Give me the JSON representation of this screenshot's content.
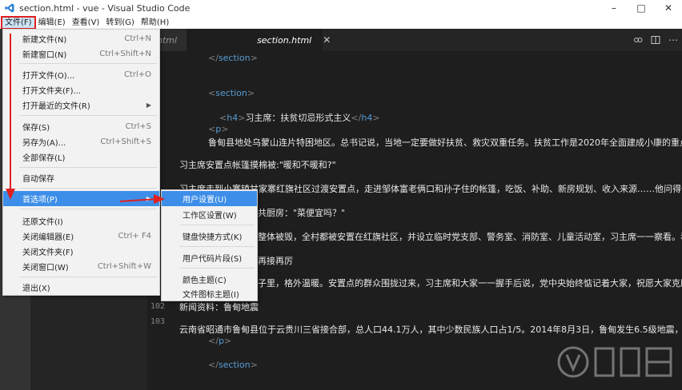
{
  "window": {
    "title": "section.html - vue - Visual Studio Code"
  },
  "menubar": {
    "items": [
      "文件(F)",
      "编辑(E)",
      "查看(V)",
      "转到(G)",
      "帮助(H)"
    ]
  },
  "tabs": [
    {
      "label": "html",
      "active": false
    },
    {
      "label": "section.html",
      "active": true
    }
  ],
  "file_menu": {
    "items": [
      {
        "label": "新建文件(N)",
        "shortcut": "Ctrl+N"
      },
      {
        "label": "新建窗口(N)",
        "shortcut": "Ctrl+Shift+N"
      },
      {
        "label": "打开文件(O)...",
        "shortcut": "Ctrl+O"
      },
      {
        "label": "打开文件夹(F)...",
        "shortcut": ""
      },
      {
        "label": "打开最近的文件(R)",
        "shortcut": ""
      },
      {
        "label": "保存(S)",
        "shortcut": "Ctrl+S"
      },
      {
        "label": "另存为(A)...",
        "shortcut": "Ctrl+Shift+S"
      },
      {
        "label": "全部保存(L)",
        "shortcut": ""
      },
      {
        "label": "自动保存",
        "shortcut": ""
      },
      {
        "label": "首选项(P)",
        "shortcut": ""
      },
      {
        "label": "还原文件(I)",
        "shortcut": ""
      },
      {
        "label": "关闭编辑器(E)",
        "shortcut": "Ctrl+ F4"
      },
      {
        "label": "关闭文件夹(F)",
        "shortcut": ""
      },
      {
        "label": "关闭窗口(W)",
        "shortcut": "Ctrl+Shift+W"
      },
      {
        "label": "退出(X)",
        "shortcut": ""
      }
    ]
  },
  "prefs_submenu": {
    "items": [
      "用户设置(U)",
      "工作区设置(W)",
      "键盘快捷方式(K)",
      "用户代码片段(S)",
      "颜色主题(C)",
      "文件图标主题(I)"
    ]
  },
  "editor": {
    "line_numbers": [
      "102",
      "103"
    ],
    "lines": {
      "l1_tag": "section",
      "l2_tag": "section",
      "l3_tag": "h4",
      "l3_text": "习主席：扶贫切忌形式主义",
      "l4_tag": "p",
      "l5": "鲁甸县地处乌蒙山连片特困地区。总书记说，当地一定要做好扶贫、救灾双重任务。扶贫工作是2020年全面建成小康的重点",
      "l6": "习主席安置点帐篷摸棉被:\"暖和不暖和?\"",
      "l7": "习主席走到小寨镇甘家寨红旗社区过渡安置点，走进邹体富老俩口和孙子住的帐篷，吃饭、补助、新房规划、收入来源……他问得十分",
      "l8": "共厨房：\"菜便宜吗？\"",
      "l9": "整体被毁，全村都被安置在红旗社区，并设立临时党支部、警务室、消防室、儿童活动室，习主席一一察看。看",
      "l10": "再接再厉",
      "l11": "子里，格外温暖。安置点的群众围拢过来，习主席和大家一一握手后说，党中央始终惦记着大家，祝愿大家克服",
      "l12": "新闻资料：鲁甸地震",
      "l13": "云南省昭通市鲁甸县位于云贵川三省接合部，总人口44.1万人，其中少数民族人口占1/5。2014年8月3日，鲁甸发生6.5级地震，震",
      "l14_tag": "p",
      "l15_tag": "section"
    }
  },
  "colors": {
    "highlight": "#3d8ee8",
    "annotation_red": "#e02020",
    "tag_blue": "#569cd6"
  }
}
